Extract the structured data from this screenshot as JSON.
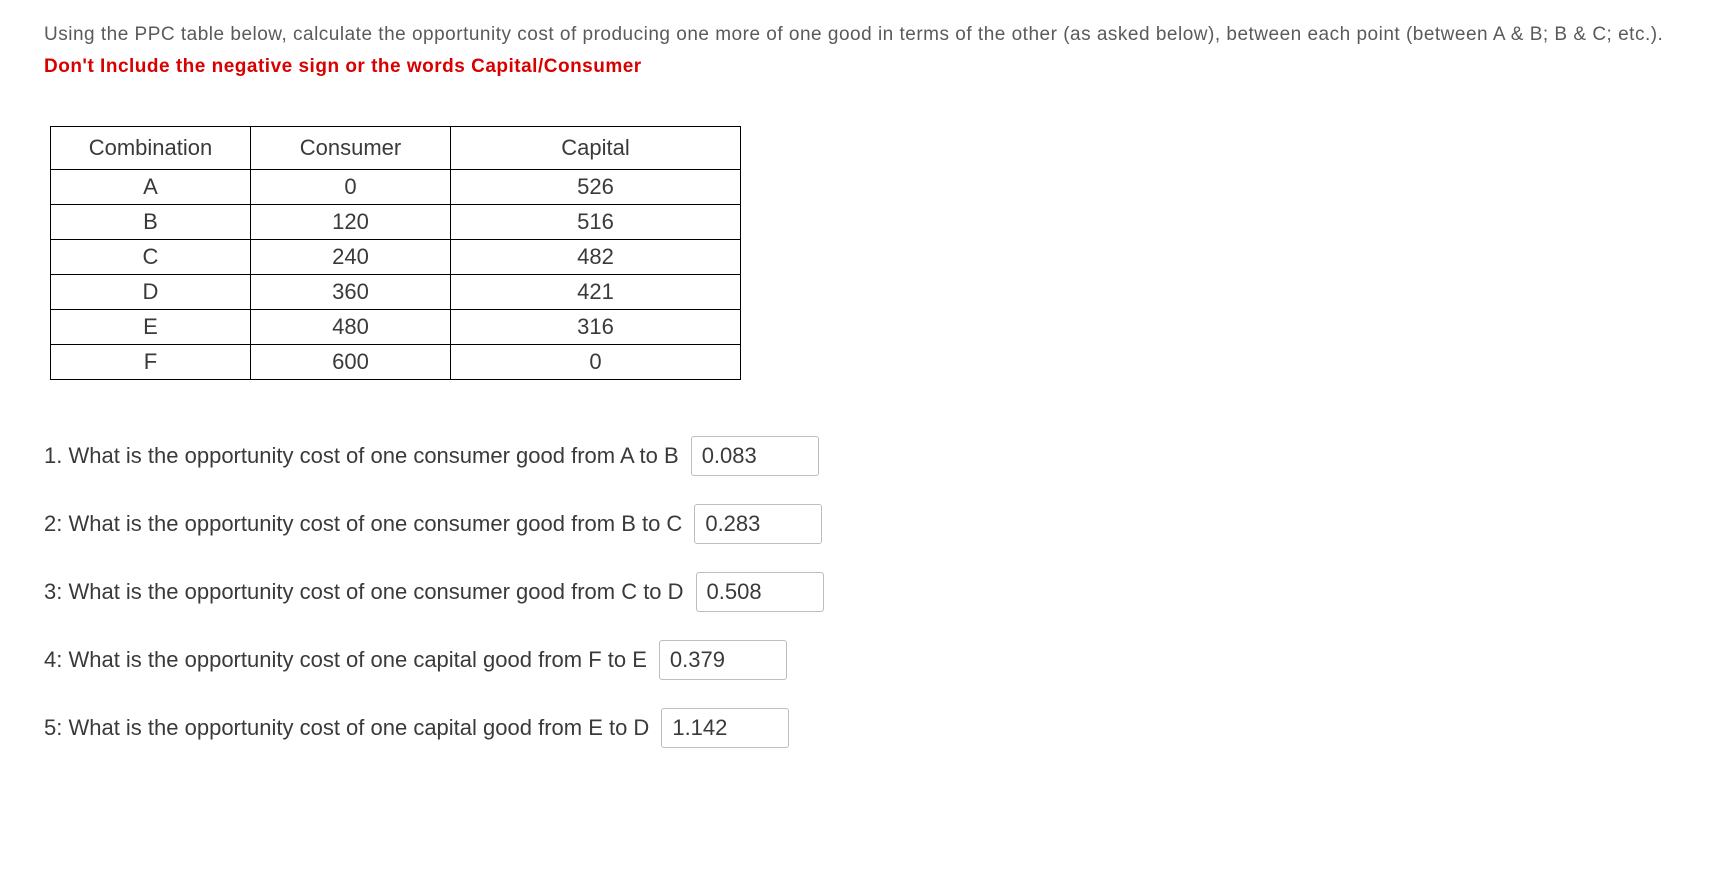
{
  "instructions": "Using the PPC table below, calculate the opportunity cost of producing one more of one good in terms of the other (as asked below), between each point (between A & B; B & C; etc.).",
  "warning": "Don't Include the negative sign or the words Capital/Consumer",
  "table": {
    "headers": {
      "combination": "Combination",
      "consumer": "Consumer",
      "capital": "Capital"
    },
    "rows": [
      {
        "combination": "A",
        "consumer": "0",
        "capital": "526"
      },
      {
        "combination": "B",
        "consumer": "120",
        "capital": "516"
      },
      {
        "combination": "C",
        "consumer": "240",
        "capital": "482"
      },
      {
        "combination": "D",
        "consumer": "360",
        "capital": "421"
      },
      {
        "combination": "E",
        "consumer": "480",
        "capital": "316"
      },
      {
        "combination": "F",
        "consumer": "600",
        "capital": "0"
      }
    ]
  },
  "questions": {
    "q1": {
      "label": "1.  What is the opportunity cost of one consumer good from A to B",
      "value": "0.083"
    },
    "q2": {
      "label": "2: What is the opportunity cost of one consumer good from B to C",
      "value": "0.283"
    },
    "q3": {
      "label": "3: What is the opportunity cost of one consumer good from C to D",
      "value": "0.508"
    },
    "q4": {
      "label": "4: What is the opportunity cost of one capital good from F to E",
      "value": "0.379"
    },
    "q5": {
      "label": "5: What is the opportunity cost of one capital good from E to D",
      "value": "1.142"
    }
  }
}
